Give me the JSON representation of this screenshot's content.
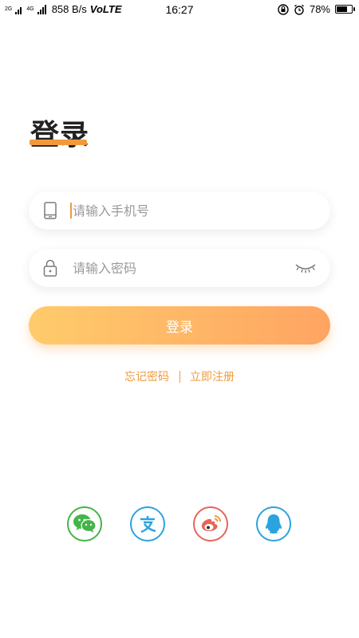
{
  "status_bar": {
    "net_2g": "2G",
    "net_4g": "4G",
    "speed": "858 B/s",
    "volte": "VoLTE",
    "time": "16:27",
    "battery_percent": "78%",
    "battery_level": 0.78
  },
  "title": "登录",
  "phone_field": {
    "placeholder": "请输入手机号",
    "icon": "phone-icon"
  },
  "password_field": {
    "placeholder": "请输入密码",
    "icon": "lock-icon",
    "toggle_icon": "eye-closed-icon"
  },
  "login_button": "登录",
  "links": {
    "forgot": "忘记密码",
    "separator": "|",
    "register": "立即注册"
  },
  "social": [
    {
      "name": "wechat-icon",
      "color": "#43b548"
    },
    {
      "name": "alipay-icon",
      "color": "#2aa3df"
    },
    {
      "name": "weibo-icon",
      "color": "#e7645a"
    },
    {
      "name": "qq-icon",
      "color": "#2aa3df"
    }
  ],
  "colors": {
    "accent": "#f29a3a",
    "button_start": "#ffcb6b",
    "button_end": "#ffa462"
  }
}
